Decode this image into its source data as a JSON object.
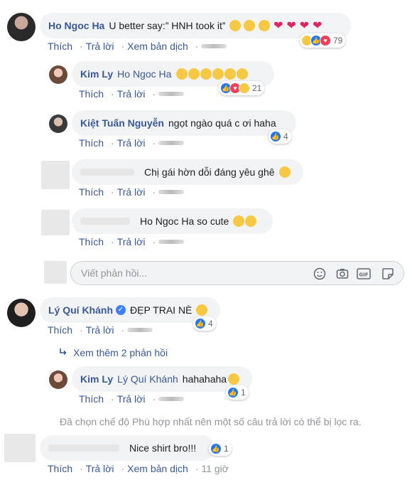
{
  "actions": {
    "like": "Thích",
    "reply": "Trả lời",
    "see_translation": "Xem bản dịch",
    "dot": "·"
  },
  "comments": [
    {
      "name": "Ho Ngoc Ha",
      "text": "U better say:” HNH took it”",
      "reaction_count": "79"
    },
    {
      "name": "Kim Ly",
      "tag": "Ho Ngoc Ha",
      "reaction_count": "21"
    },
    {
      "name": "Kiệt Tuấn Nguyễn",
      "text": "ngọt ngào quá c ơi haha",
      "reaction_count": "4"
    },
    {
      "text": "Chị gái hờn dỗi đáng yêu ghê"
    },
    {
      "text": "Ho Ngoc Ha so cute"
    }
  ],
  "reply_box": {
    "placeholder": "Viết phản hồi..."
  },
  "thread2": {
    "name": "Lý Quí Khánh",
    "text": "ĐẸP TRAI NÈ",
    "reaction_count": "4",
    "more_replies": "Xem thêm 2 phản hồi",
    "reply": {
      "name": "Kim Ly",
      "tag": "Lý Quí Khánh",
      "text": "hahahaha",
      "reaction_count": "1"
    },
    "filter_notice": "Đã chọn chế độ Phù hợp nhất nên một số câu trả lời có thể bị lọc ra."
  },
  "last_comment": {
    "text": "Nice shirt bro!!!",
    "reaction_count": "1",
    "time": "11 giờ"
  },
  "colors": {
    "link": "#385898",
    "bubble": "#f2f3f5",
    "like": "#2078f4",
    "love": "#f33e58",
    "haha": "#f7c844"
  }
}
